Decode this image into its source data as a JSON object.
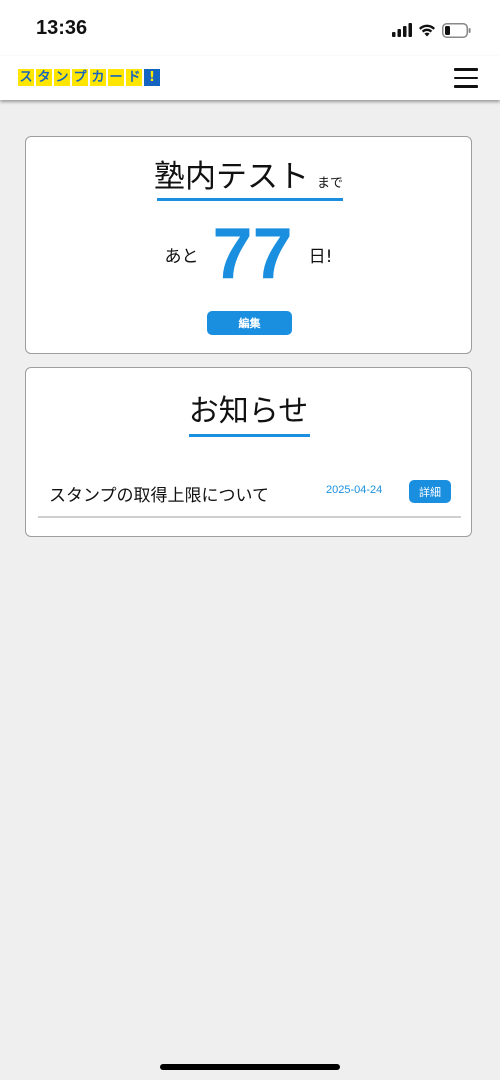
{
  "status_bar": {
    "time": "13:36",
    "icons": [
      "cellular-signal-icon",
      "wifi-icon",
      "battery-icon"
    ],
    "battery_level": 0.2
  },
  "header": {
    "logo_text": "スタンプカード!",
    "logo_chars": [
      "ス",
      "タ",
      "ン",
      "プ",
      "カ",
      "ー",
      "ド",
      "!"
    ],
    "logo_colors": {
      "background": "#ffe500",
      "text": "#1565c0"
    },
    "menu_icon": "hamburger-menu-icon"
  },
  "countdown": {
    "title": "塾内テスト",
    "title_suffix": "まで",
    "prefix": "あと",
    "days": "77",
    "suffix": "日!",
    "edit_label": "編集"
  },
  "news": {
    "title": "お知らせ",
    "items": [
      {
        "title": "スタンプの取得上限について",
        "date": "2025-04-24",
        "detail_label": "詳細"
      }
    ]
  },
  "colors": {
    "accent": "#1a8fe0",
    "background": "#efefef",
    "card": "#ffffff",
    "card_border": "#9e9e9e"
  }
}
